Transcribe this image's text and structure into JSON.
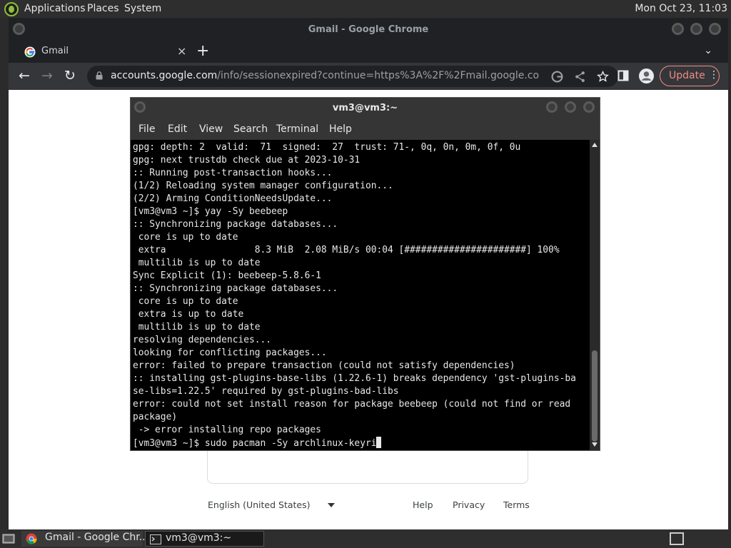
{
  "top_panel": {
    "menus": [
      "Applications",
      "Places",
      "System"
    ],
    "clock": "Mon Oct 23, 11:03"
  },
  "chrome": {
    "window_title": "Gmail - Google Chrome",
    "tab": {
      "title": "Gmail",
      "close": "×"
    },
    "new_tab": "+",
    "tab_menu": "⌄",
    "url_host": "accounts.google.com",
    "url_path": "/info/sessionexpired?continue=https%3A%2F%2Fmail.google.com%2F...",
    "update_label": "Update",
    "menu_dots": "⋮",
    "page": {
      "language": "English (United States)",
      "footer_links": [
        "Help",
        "Privacy",
        "Terms"
      ]
    }
  },
  "terminal": {
    "title": "vm3@vm3:~",
    "menu": [
      "File",
      "Edit",
      "View",
      "Search",
      "Terminal",
      "Help"
    ],
    "lines": [
      "gpg: depth: 2  valid:  71  signed:  27  trust: 71-, 0q, 0n, 0m, 0f, 0u",
      "gpg: next trustdb check due at 2023-10-31",
      ":: Running post-transaction hooks...",
      "(1/2) Reloading system manager configuration...",
      "(2/2) Arming ConditionNeedsUpdate...",
      "[vm3@vm3 ~]$ yay -Sy beebeep",
      ":: Synchronizing package databases...",
      " core is up to date",
      " extra                8.3 MiB  2.08 MiB/s 00:04 [######################] 100%",
      " multilib is up to date",
      "Sync Explicit (1): beebeep-5.8.6-1",
      ":: Synchronizing package databases...",
      " core is up to date",
      " extra is up to date",
      " multilib is up to date",
      "resolving dependencies...",
      "looking for conflicting packages...",
      "error: failed to prepare transaction (could not satisfy dependencies)",
      ":: installing gst-plugins-base-libs (1.22.6-1) breaks dependency 'gst-plugins-ba",
      "se-libs=1.22.5' required by gst-plugins-bad-libs",
      "error: could not set install reason for package beebeep (could not find or read",
      "package)",
      " -> error installing repo packages"
    ],
    "prompt_line": "[vm3@vm3 ~]$ sudo pacman -Sy archlinux-keyri"
  },
  "taskbar": {
    "tasks": [
      "Gmail - Google Chr...",
      "vm3@vm3:~"
    ]
  },
  "colors": {
    "chrome_dark": "#202124",
    "toolbar": "#35363a",
    "update_accent": "#f28b82",
    "terminal_bg": "#000000",
    "panel": "#2e2e2e"
  },
  "icons": [
    "mint-logo-icon",
    "google-g-icon",
    "lock-icon",
    "share-icon",
    "star-icon",
    "sidebar-icon",
    "profile-icon",
    "chrome-icon",
    "terminal-icon",
    "show-desktop-icon"
  ]
}
